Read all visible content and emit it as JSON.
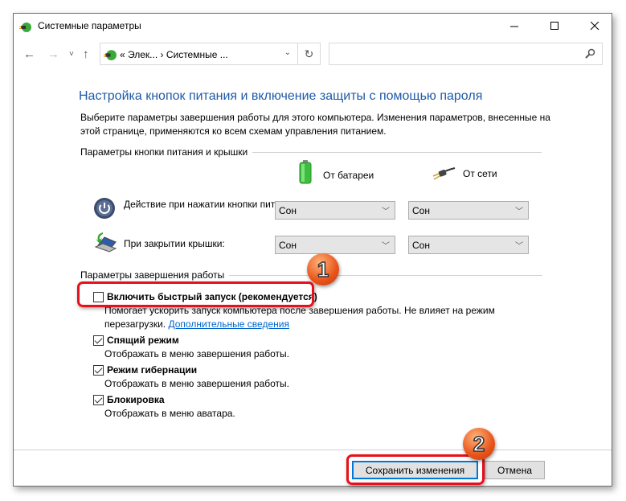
{
  "window": {
    "title": "Системные параметры",
    "minimize_label": "—",
    "maximize_label": "☐",
    "close_label": "✕"
  },
  "nav": {
    "back": "←",
    "forward": "→",
    "recent": "˅",
    "up": "↑",
    "address": "« Элек... › Системные ...",
    "address_dropdown": "⌄",
    "refresh": "↻",
    "search_placeholder": ""
  },
  "main": {
    "heading": "Настройка кнопок питания и включение защиты с помощью пароля",
    "description": "Выберите параметры завершения работы для этого компьютера. Изменения параметров, внесенные на этой странице, применяются ко всем схемам управления питанием.",
    "power_group_label": "Параметры кнопки питания и крышки",
    "columns": {
      "battery": "От батареи",
      "plugged_in": "От сети"
    },
    "rows": [
      {
        "label": "Действие при нажатии кнопки питания:",
        "battery": "Сон",
        "plugged_in": "Сон"
      },
      {
        "label": "При закрытии крышки:",
        "battery": "Сон",
        "plugged_in": "Сон"
      }
    ],
    "shutdown_group_label": "Параметры завершения работы",
    "options": [
      {
        "label": "Включить быстрый запуск (рекомендуется)",
        "checked": false,
        "desc": "Помогает ускорить запуск компьютера после завершения работы. Не влияет на режим",
        "desc2": "перезагрузки.",
        "link": "Дополнительные сведения"
      },
      {
        "label": "Спящий режим",
        "checked": true,
        "desc": "Отображать в меню завершения работы."
      },
      {
        "label": "Режим гибернации",
        "checked": true,
        "desc": "Отображать в меню завершения работы."
      },
      {
        "label": "Блокировка",
        "checked": true,
        "desc": "Отображать в меню аватара."
      }
    ]
  },
  "footer": {
    "save_label": "Сохранить изменения",
    "cancel_label": "Отмена"
  },
  "annotations": {
    "badge1": "1",
    "badge2": "2",
    "highlight_color": "#e8101a"
  }
}
